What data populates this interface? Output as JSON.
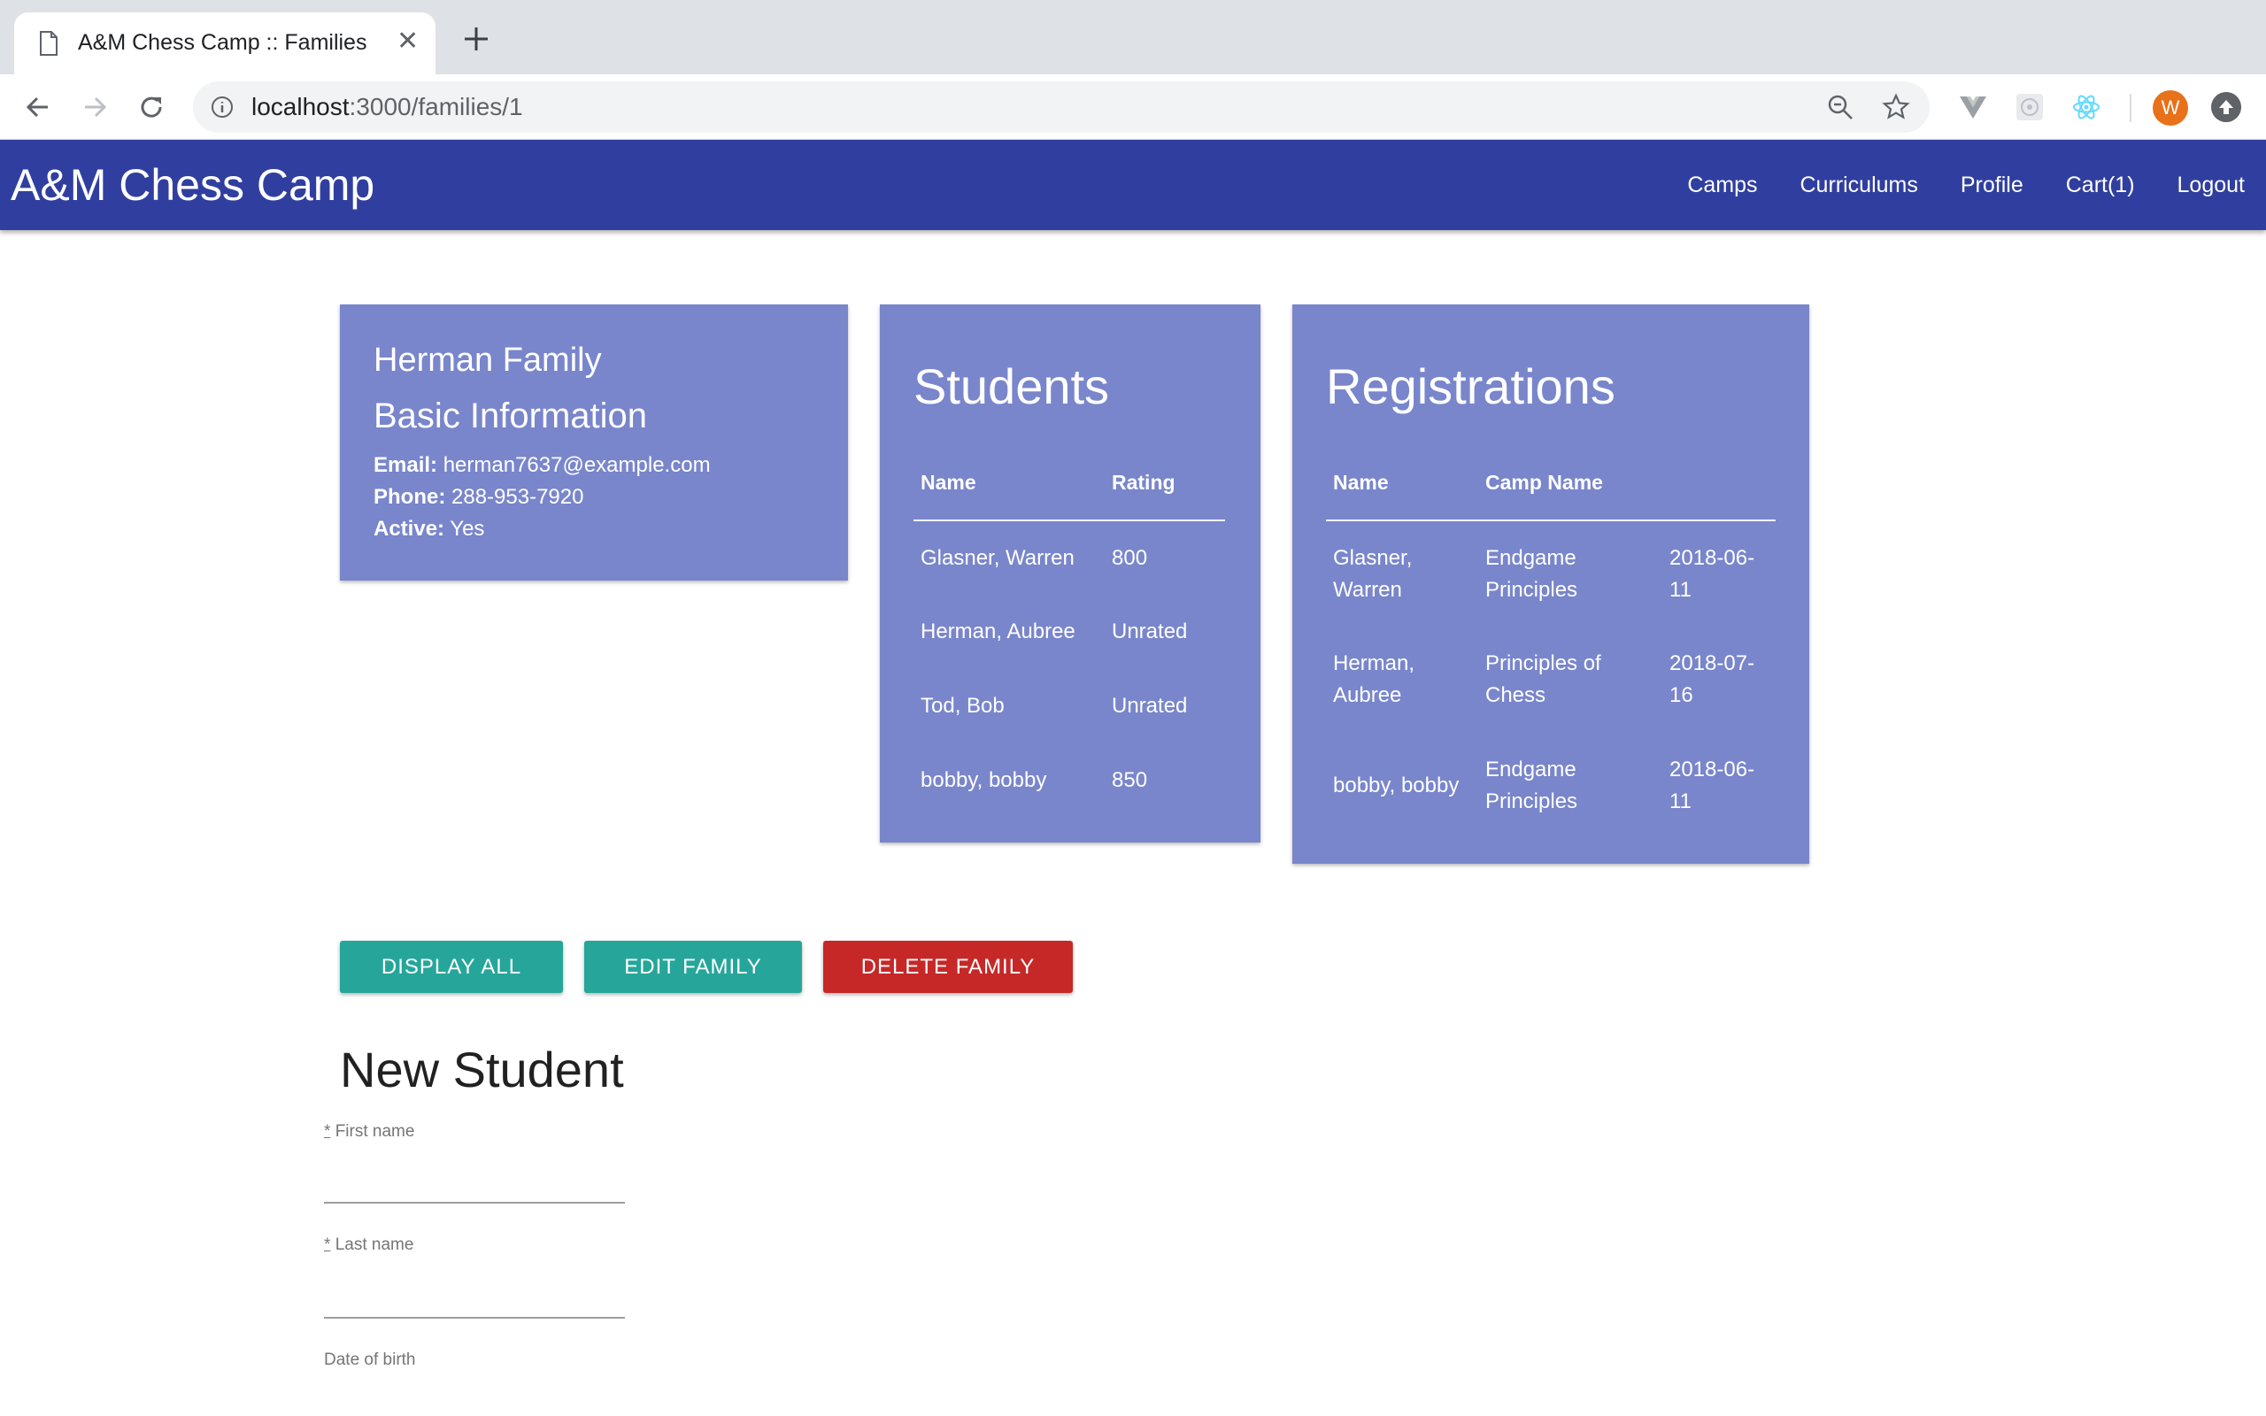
{
  "browser": {
    "tab_title": "A&M Chess Camp :: Families",
    "url_host": "localhost",
    "url_rest": ":3000/families/1",
    "avatar_letter": "W"
  },
  "app": {
    "brand": "A&M Chess Camp",
    "nav": [
      "Camps",
      "Curriculums",
      "Profile",
      "Cart(1)",
      "Logout"
    ]
  },
  "family": {
    "name": "Herman Family",
    "section_title": "Basic Information",
    "email_label": "Email:",
    "email": "herman7637@example.com",
    "phone_label": "Phone:",
    "phone": "288-953-7920",
    "active_label": "Active:",
    "active": "Yes"
  },
  "students": {
    "title": "Students",
    "headers": [
      "Name",
      "Rating"
    ],
    "rows": [
      [
        "Glasner, Warren",
        "800"
      ],
      [
        "Herman, Aubree",
        "Unrated"
      ],
      [
        "Tod, Bob",
        "Unrated"
      ],
      [
        "bobby, bobby",
        "850"
      ]
    ]
  },
  "registrations": {
    "title": "Registrations",
    "headers": [
      "Name",
      "Camp Name",
      ""
    ],
    "rows": [
      [
        "Glasner, Warren",
        "Endgame Principles",
        "2018-06-11"
      ],
      [
        "Herman, Aubree",
        "Principles of Chess",
        "2018-07-16"
      ],
      [
        "bobby, bobby",
        "Endgame Principles",
        "2018-06-11"
      ]
    ]
  },
  "actions": {
    "display_all": "DISPLAY ALL",
    "edit_family": "EDIT FAMILY",
    "delete_family": "DELETE FAMILY"
  },
  "form": {
    "title": "New Student",
    "required_mark": "*",
    "first_name_label": "First name",
    "first_name_value": "",
    "last_name_label": "Last name",
    "last_name_value": "",
    "dob_label": "Date of birth"
  },
  "colors": {
    "appbar": "#303f9f",
    "card": "#7986cb",
    "teal_button": "#26a69a",
    "red_button": "#c62828"
  }
}
